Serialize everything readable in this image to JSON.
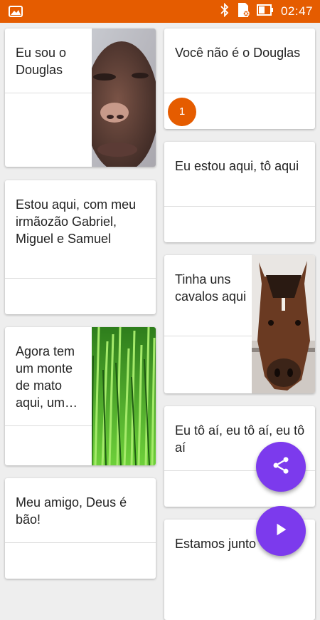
{
  "status_bar": {
    "time": "02:47",
    "icons": [
      "image-icon",
      "bluetooth-icon",
      "sim-off-icon",
      "battery-icon"
    ]
  },
  "cards": [
    {
      "text": "Eu sou o Douglas",
      "image": "face-photo"
    },
    {
      "text": "Você não é o Douglas",
      "badge": "1"
    },
    {
      "text": "Eu estou aqui, tô aqui"
    },
    {
      "text": "Estou aqui, com meu irmãozão Gabriel, Miguel e Samuel"
    },
    {
      "text": "Tinha uns cavalos aqui",
      "image": "horse-photo"
    },
    {
      "text": "Agora tem um monte de mato aqui, um…",
      "image": "grass-photo"
    },
    {
      "text": "Eu tô aí, eu tô aí, eu tô aí"
    },
    {
      "text": "Meu amigo, Deus é bão!"
    },
    {
      "text": "Estamos junto"
    }
  ],
  "fabs": {
    "share": "share-icon",
    "play": "play-icon"
  },
  "colors": {
    "status_bar": "#e55c00",
    "badge": "#e55c00",
    "fab": "#7c3aed"
  }
}
